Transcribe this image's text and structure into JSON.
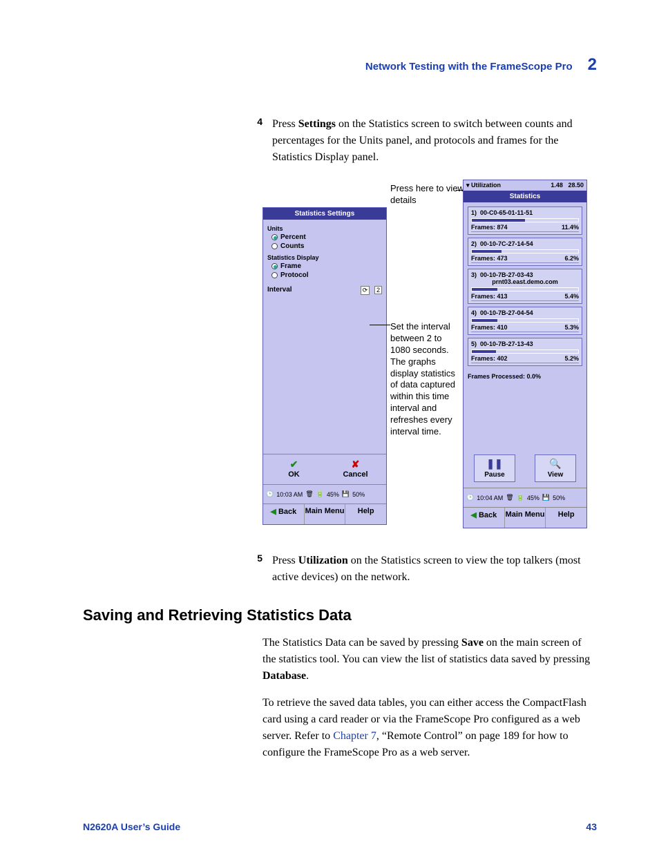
{
  "header": {
    "title": "Network Testing with the FrameScope Pro",
    "chapter": "2"
  },
  "steps": {
    "s4": {
      "num": "4",
      "prefix": "Press ",
      "bold": "Settings",
      "suffix": " on the Statistics screen to switch between counts and percentages for the Units panel, and protocols and frames for the Statistics Display panel."
    },
    "s5": {
      "num": "5",
      "prefix": "Press ",
      "bold": "Utilization",
      "suffix": " on the Statistics screen to view the top talkers (most active devices) on the network."
    }
  },
  "callouts": {
    "c1": "Press here to view details",
    "c2": "Set the interval between 2 to 1080 seconds. The graphs display statistics of data captured within this time interval and refreshes every interval time."
  },
  "settingsScreen": {
    "title": "Statistics Settings",
    "unitsLabel": "Units",
    "percent": "Percent",
    "counts": "Counts",
    "statsDisplayLabel": "Statistics Display",
    "frame": "Frame",
    "protocol": "Protocol",
    "intervalLabel": "Interval",
    "intervalValue": "2",
    "ok": "OK",
    "cancel": "Cancel",
    "time": "10:03 AM",
    "batt": "45%",
    "mem": "50%",
    "back": "Back",
    "main": "Main Menu",
    "help": "Help"
  },
  "statsScreen": {
    "utilLabel": "Utilization",
    "utilA": "1.48",
    "utilB": "28.50",
    "title": "Statistics",
    "items": [
      {
        "idx": "1)",
        "mac": "00-C0-65-01-11-51",
        "frames": "Frames: 874",
        "pct": "11.4%",
        "w": "50%"
      },
      {
        "idx": "2)",
        "mac": "00-10-7C-27-14-54",
        "frames": "Frames: 473",
        "pct": "6.2%",
        "w": "28%"
      },
      {
        "idx": "3)",
        "mac": "00-10-7B-27-03-43",
        "host": "prnt03.east.demo.com",
        "frames": "Frames: 413",
        "pct": "5.4%",
        "w": "24%"
      },
      {
        "idx": "4)",
        "mac": "00-10-7B-27-04-54",
        "frames": "Frames: 410",
        "pct": "5.3%",
        "w": "24%"
      },
      {
        "idx": "5)",
        "mac": "00-10-7B-27-13-43",
        "frames": "Frames: 402",
        "pct": "5.2%",
        "w": "23%"
      }
    ],
    "processed": "Frames Processed: 0.0%",
    "pause": "Pause",
    "view": "View",
    "time": "10:04 AM",
    "batt": "45%",
    "mem": "50%",
    "back": "Back",
    "main": "Main Menu",
    "help": "Help"
  },
  "section": {
    "heading": "Saving and Retrieving Statistics Data"
  },
  "paras": {
    "p1a": "The Statistics Data can be saved by pressing ",
    "p1b": "Save",
    "p1c": " on the main screen of the statistics tool. You can view the list of statistics data saved by pressing ",
    "p1d": "Database",
    "p1e": ".",
    "p2a": "To retrieve the saved data tables, you can either access the CompactFlash card using a card reader or via the FrameScope Pro configured as a web server. Refer to ",
    "p2link": "Chapter 7",
    "p2b": ", “Remote Control” on page 189 for how to configure the FrameScope Pro as a web server."
  },
  "footer": {
    "guide": "N2620A User’s Guide",
    "page": "43"
  }
}
